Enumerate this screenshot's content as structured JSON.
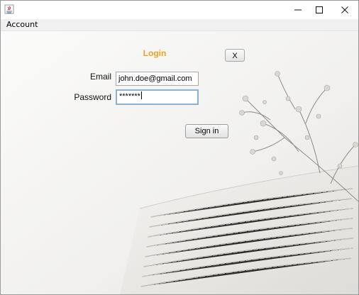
{
  "window": {
    "title": ""
  },
  "menu": {
    "items": [
      {
        "label": "Account"
      }
    ]
  },
  "login": {
    "title": "Login",
    "close_label": "X",
    "email_label": "Email",
    "email_value": "john.doe@gmail.com",
    "password_label": "Password",
    "password_value": "*******",
    "signin_label": "Sign in"
  },
  "colors": {
    "title_accent": "#f0a020",
    "focus_border": "#8bb1d6"
  }
}
